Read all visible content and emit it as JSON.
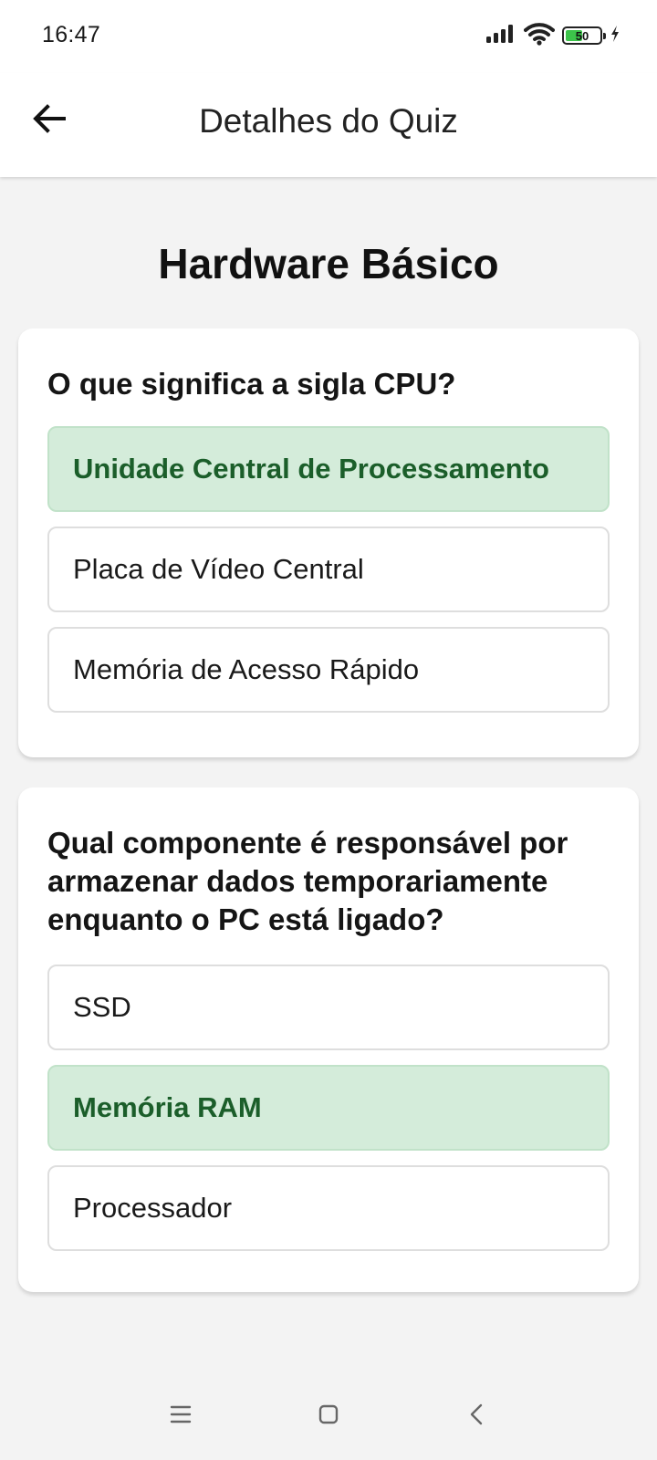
{
  "status_bar": {
    "time": "16:47",
    "battery_level": "50",
    "battery_fraction": 0.5,
    "icons": [
      "signal-icon",
      "wifi-icon",
      "battery-icon",
      "charging-icon"
    ]
  },
  "header": {
    "back_icon": "arrow-left-icon",
    "title": "Detalhes do Quiz"
  },
  "quiz": {
    "title": "Hardware Básico",
    "questions": [
      {
        "text": "O que significa a sigla CPU?",
        "options": [
          {
            "label": "Unidade Central de Processamento",
            "correct": true
          },
          {
            "label": "Placa de Vídeo Central",
            "correct": false
          },
          {
            "label": "Memória de Acesso Rápido",
            "correct": false
          }
        ]
      },
      {
        "text": "Qual componente é responsável por armazenar dados temporariamente enquanto o PC está ligado?",
        "options": [
          {
            "label": "SSD",
            "correct": false
          },
          {
            "label": "Memória RAM",
            "correct": true
          },
          {
            "label": "Processador",
            "correct": false
          }
        ]
      }
    ]
  },
  "nav_bar": {
    "icons": [
      "menu-icon",
      "home-square-icon",
      "back-chevron-icon"
    ]
  },
  "colors": {
    "correct_bg": "#d4ecda",
    "correct_text": "#1b5e2a",
    "page_bg": "#f3f3f3",
    "battery_green": "#3cc44a"
  }
}
